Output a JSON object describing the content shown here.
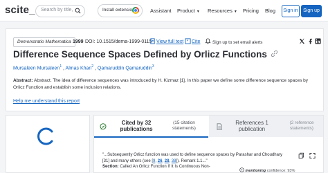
{
  "nav": {
    "logo": "scite_",
    "search_placeholder": "Search by title,",
    "install_label": "Install extension!",
    "items": [
      "Assistant",
      "Product",
      "Resources",
      "Pricing",
      "Blog"
    ],
    "signin": "Sign in",
    "signup": "Sign up"
  },
  "paper": {
    "journal": "Demonstratio Mathematica",
    "year": "1999",
    "doi": "DOI: 10.1515/dema-1999-0115",
    "full_text": "View full text",
    "cite": "Cite",
    "alerts": "Sign up to set email alerts",
    "title": "Difference Sequence Spaces Defined by Orlicz Functions",
    "authors": [
      "Mursaleen Mursaleen",
      "Almas Khan",
      "Qamaruddin Qamaruddin"
    ],
    "author_sups": [
      "1",
      "2",
      "3"
    ],
    "abstract_label": "Abstract:",
    "abstract_text": "Abstract. The idea of difference sequences was introduced by H. Kizmaz [1], In this paper we define some difference sequence spaces by Orlicz Function and establish some inclusion relations.",
    "help": "Help me understand this report"
  },
  "tabs": {
    "cited_title_1": "Cited by 32",
    "cited_title_2": "publications",
    "cited_sub_1": "(15 citation",
    "cited_sub_2": "statements)",
    "refs_title_1": "References 1",
    "refs_title_2": "publication",
    "refs_sub_1": "(2 reference",
    "refs_sub_2": "statements)"
  },
  "snippet": {
    "line1": "\"...Subsequently Orlicz function was used to define sequence spaces by Parashar and Choudhary",
    "line2_pre": "[31] and many others (see [",
    "c1": "9",
    "sep1": ", ",
    "c2": "26",
    "sep2": ", ",
    "c3": "28",
    "sep3": ", ",
    "c4": "38",
    "line2_post": "]). Remark 1.1...\"",
    "section_label": "Section:",
    "section_text": "Called An Orlicz Function If It Is Continuous Non-",
    "mention_label": "mentioning",
    "confidence": "confidence: 93%"
  },
  "colors": {
    "accent": "#1565c0",
    "text": "#2b2d33",
    "background": "#f4f5f7"
  }
}
